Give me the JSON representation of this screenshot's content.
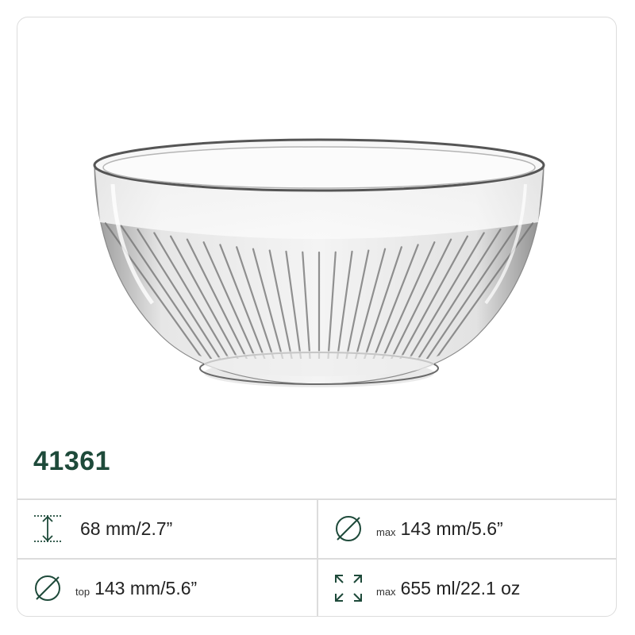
{
  "product": {
    "sku": "41361"
  },
  "specs": [
    {
      "icon": "height-arrows-icon",
      "prefix": "",
      "value": "68 mm/2.7”"
    },
    {
      "icon": "diameter-icon",
      "prefix": "max",
      "value": "143 mm/5.6”"
    },
    {
      "icon": "diameter-icon",
      "prefix": "top",
      "value": "143 mm/5.6”"
    },
    {
      "icon": "capacity-expand-icon",
      "prefix": "max",
      "value": "655 ml/22.1 oz"
    }
  ],
  "colors": {
    "accent": "#1e4a3a",
    "border": "#dcdcdc",
    "icon": "#1e4a3a"
  }
}
